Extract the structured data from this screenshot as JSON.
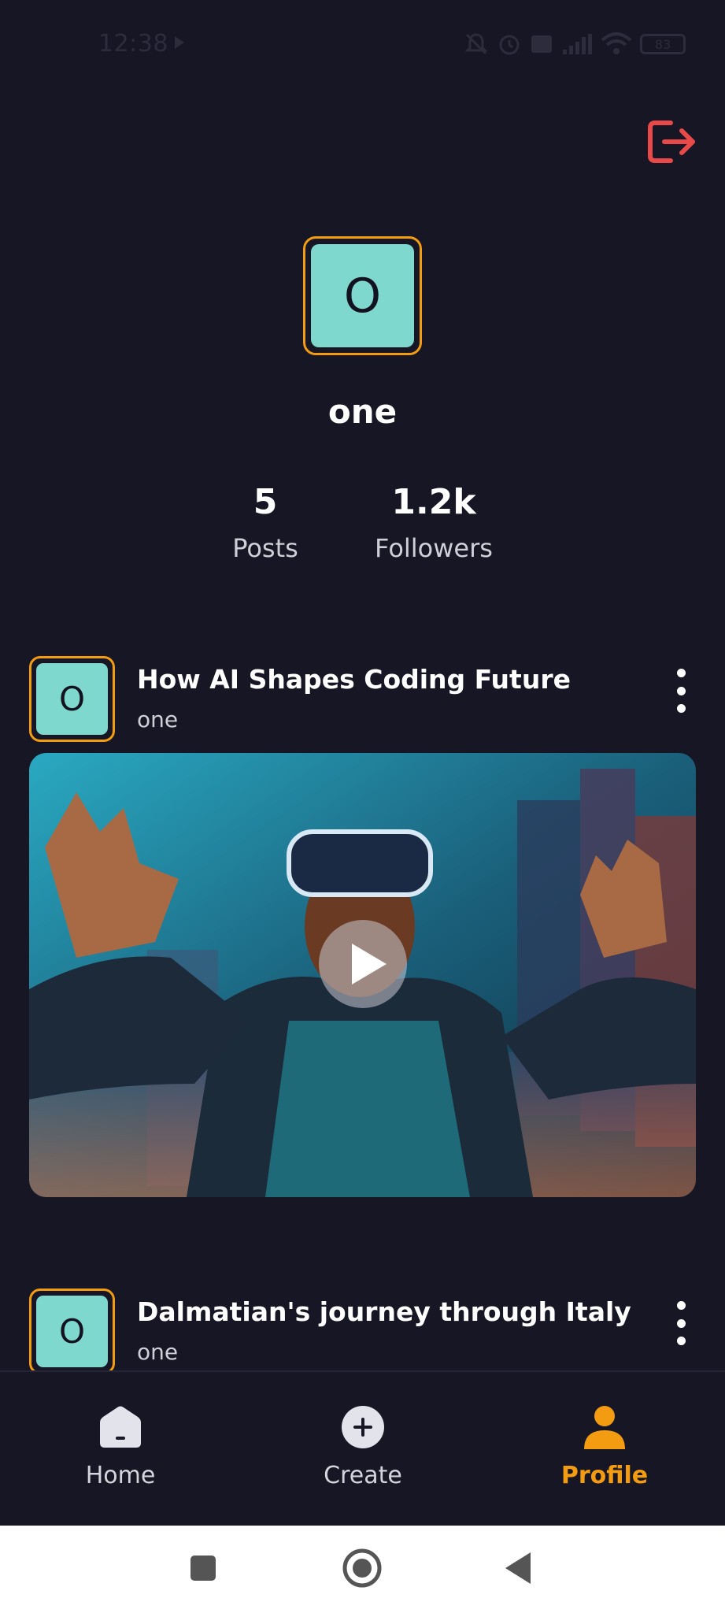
{
  "status_bar": {
    "time": "12:38",
    "battery": "83"
  },
  "profile": {
    "avatar_letter": "O",
    "username": "one",
    "stats": {
      "posts_value": "5",
      "posts_label": "Posts",
      "followers_value": "1.2k",
      "followers_label": "Followers"
    }
  },
  "posts": [
    {
      "avatar_letter": "O",
      "title": "How AI Shapes Coding Future",
      "author": "one",
      "media": "video"
    },
    {
      "avatar_letter": "O",
      "title": "Dalmatian's journey through Italy",
      "author": "one"
    }
  ],
  "bottom_nav": {
    "items": [
      {
        "label": "Home",
        "icon": "home-icon"
      },
      {
        "label": "Create",
        "icon": "plus-circle-icon"
      },
      {
        "label": "Profile",
        "icon": "person-icon",
        "active": true
      }
    ]
  },
  "colors": {
    "background": "#161624",
    "accent": "#f39c12",
    "avatar_bg": "#7fd8cd",
    "logout": "#e84a4a"
  }
}
